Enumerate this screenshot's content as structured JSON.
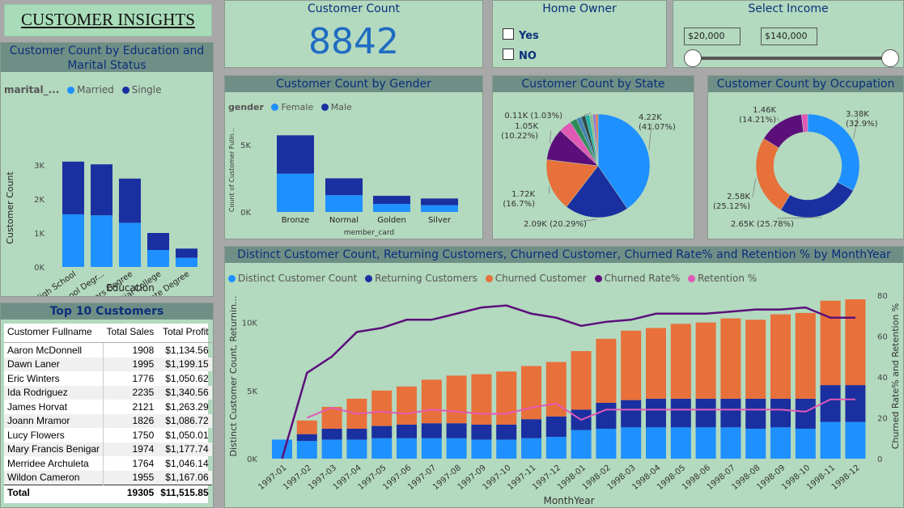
{
  "app_title": "CUSTOMER INSIGHTS",
  "colors": {
    "light_blue": "#1e90ff",
    "dark_blue": "#1a2fa0",
    "orange": "#e8703a",
    "purple": "#5c0f7a",
    "pink": "#e05ab5",
    "panel_bg": "#b3d9bf",
    "title_bar": "#6f8f86",
    "title_text": "#0b2f7a"
  },
  "kpi": {
    "title": "Customer Count",
    "value": "8842"
  },
  "home_owner": {
    "title": "Home Owner",
    "options": [
      {
        "label": "Yes",
        "checked": false
      },
      {
        "label": "NO",
        "checked": false
      }
    ]
  },
  "income": {
    "title": "Select Income",
    "min": "$20,000",
    "max": "$140,000"
  },
  "education_panel": {
    "title": "Customer Count by Education and Marital Status",
    "legend_title": "marital_...",
    "xlabel": "Education",
    "ylabel": "Customer Count"
  },
  "gender_panel": {
    "title": "Customer Count by Gender",
    "legend_title": "gender",
    "xlabel": "member_card",
    "ylabel": "Count of Customer Fulln..."
  },
  "state_panel": {
    "title": "Customer Count by State"
  },
  "occupation_panel": {
    "title": "Customer Count by Occupation"
  },
  "top10": {
    "title": "Top 10 Customers",
    "headers": [
      "Customer Fullname",
      "Total Sales",
      "Total Profit"
    ],
    "rows": [
      [
        "Aaron McDonnell",
        "1908",
        "$1,134.56"
      ],
      [
        "Dawn Laner",
        "1995",
        "$1,199.15"
      ],
      [
        "Eric Winters",
        "1776",
        "$1,050.62"
      ],
      [
        "Ida Rodriguez",
        "2235",
        "$1,340.56"
      ],
      [
        "James Horvat",
        "2121",
        "$1,263.29"
      ],
      [
        "Joann Mramor",
        "1826",
        "$1,086.72"
      ],
      [
        "Lucy Flowers",
        "1750",
        "$1,050.01"
      ],
      [
        "Mary Francis Benigar",
        "1974",
        "$1,177.74"
      ],
      [
        "Merridee Archuleta",
        "1764",
        "$1,046.14"
      ],
      [
        "Wildon Cameron",
        "1955",
        "$1,167.06"
      ]
    ],
    "total": [
      "Total",
      "19305",
      "$11,515.85"
    ]
  },
  "combo_panel": {
    "title": "Distinct Customer Count, Returning Customers, Churned Customer, Churned Rate% and Retention % by MonthYear"
  },
  "chart_data": [
    {
      "type": "bar",
      "stacked": true,
      "categories": [
        "Partial High School",
        "High School Degr...",
        "Bachelors Degree",
        "Partial College",
        "Graduate Degree"
      ],
      "series": [
        {
          "name": "Married",
          "values": [
            1550,
            1520,
            1300,
            500,
            270
          ]
        },
        {
          "name": "Single",
          "values": [
            1550,
            1500,
            1300,
            500,
            270
          ]
        }
      ],
      "xlabel": "Education",
      "ylabel": "Customer Count",
      "yticks": [
        "0K",
        "1K",
        "2K",
        "3K"
      ],
      "ylim": [
        0,
        3500
      ]
    },
    {
      "type": "bar",
      "stacked": true,
      "categories": [
        "Bronze",
        "Normal",
        "Golden",
        "Silver"
      ],
      "series": [
        {
          "name": "Female",
          "values": [
            2850,
            1250,
            600,
            500
          ]
        },
        {
          "name": "Male",
          "values": [
            2850,
            1250,
            600,
            500
          ]
        }
      ],
      "xlabel": "member_card",
      "ylabel": "Count of Customer Fulln...",
      "yticks": [
        "0K",
        "5K"
      ],
      "ylim": [
        0,
        6500
      ]
    },
    {
      "type": "pie",
      "slices": [
        {
          "value": 4220,
          "color": "#1e90ff",
          "label1": "4.22K",
          "label2": "(41.07%)"
        },
        {
          "value": 2090,
          "color": "#1a2fa0",
          "label1": "2.09K (20.29%)",
          "label2": ""
        },
        {
          "value": 1720,
          "color": "#e8703a",
          "label1": "1.72K",
          "label2": "(16.7%)"
        },
        {
          "value": 1050,
          "color": "#5c0f7a",
          "label1": "1.05K",
          "label2": "(10.22%)"
        },
        {
          "value": 420,
          "color": "#e05ab5",
          "label1": "",
          "label2": ""
        },
        {
          "value": 220,
          "color": "#2e8b57",
          "label1": "",
          "label2": ""
        },
        {
          "value": 160,
          "color": "#4682b4",
          "label1": "",
          "label2": ""
        },
        {
          "value": 150,
          "color": "#2f4f4f",
          "label1": "",
          "label2": ""
        },
        {
          "value": 130,
          "color": "#20b2aa",
          "label1": "",
          "label2": ""
        },
        {
          "value": 110,
          "color": "#8fbc8f",
          "label1": "0.11K (1.03%)",
          "label2": ""
        },
        {
          "value": 90,
          "color": "#9370db",
          "label1": "",
          "label2": ""
        },
        {
          "value": 80,
          "color": "#e07050",
          "label1": "",
          "label2": ""
        }
      ]
    },
    {
      "type": "pie",
      "donut": true,
      "slices": [
        {
          "value": 3380,
          "color": "#1e90ff",
          "label1": "3.38K",
          "label2": "(32.9%)"
        },
        {
          "value": 2650,
          "color": "#1a2fa0",
          "label1": "2.65K (25.78%)",
          "label2": ""
        },
        {
          "value": 2580,
          "color": "#e8703a",
          "label1": "2.58K",
          "label2": "(25.12%)"
        },
        {
          "value": 1460,
          "color": "#5c0f7a",
          "label1": "1.46K",
          "label2": "(14.21%)"
        },
        {
          "value": 200,
          "color": "#e05ab5",
          "label1": "",
          "label2": ""
        }
      ]
    },
    {
      "type": "bar+line",
      "categories": [
        "1997-01",
        "1997-02",
        "1997-03",
        "1997-04",
        "1997-05",
        "1997-06",
        "1997-07",
        "1997-08",
        "1997-09",
        "1997-10",
        "1997-11",
        "1997-12",
        "1998-01",
        "1998-02",
        "1998-03",
        "1998-04",
        "1998-05",
        "1998-06",
        "1998-07",
        "1998-08",
        "1998-09",
        "1998-10",
        "1998-11",
        "1998-12"
      ],
      "series": [
        {
          "name": "Distinct Customer Count",
          "axis": "left",
          "values": [
            1400,
            1300,
            1400,
            1400,
            1500,
            1500,
            1500,
            1500,
            1400,
            1400,
            1500,
            1600,
            2100,
            2200,
            2300,
            2300,
            2300,
            2300,
            2300,
            2200,
            2300,
            2200,
            2700,
            2700
          ]
        },
        {
          "name": "Returning Customers",
          "axis": "left",
          "values": [
            0,
            500,
            800,
            800,
            900,
            1000,
            1100,
            1100,
            1100,
            1100,
            1400,
            1500,
            1500,
            1900,
            2000,
            2100,
            2100,
            2100,
            2100,
            2200,
            2100,
            2200,
            2700,
            2700
          ]
        },
        {
          "name": "Churned Customer",
          "axis": "left",
          "values": [
            0,
            1000,
            1600,
            2200,
            2600,
            2800,
            3200,
            3500,
            3700,
            3900,
            3900,
            4000,
            4300,
            4700,
            5100,
            5200,
            5500,
            5600,
            5900,
            5800,
            6200,
            6300,
            6200,
            6300
          ]
        },
        {
          "name": "Churned Rate%",
          "axis": "right",
          "values": [
            0,
            42,
            50,
            62,
            64,
            68,
            68,
            71,
            74,
            75,
            71,
            69,
            65,
            67,
            68,
            71,
            71,
            71,
            72,
            73,
            73,
            74,
            69,
            69
          ]
        },
        {
          "name": "Retention %",
          "axis": "right",
          "values": [
            null,
            20,
            25,
            22,
            23,
            22,
            24,
            23,
            22,
            22,
            25,
            27,
            19,
            24,
            24,
            24,
            24,
            24,
            24,
            24,
            24,
            23,
            29,
            29
          ]
        }
      ],
      "xlabel": "MonthYear",
      "ylabel_left": "Distinct Customer Count, Returnin...",
      "ylabel_right": "Churned Rate% and Retention %",
      "yticks_left": [
        "0K",
        "5K",
        "10K"
      ],
      "ylim_left": [
        0,
        12000
      ],
      "yticks_right": [
        "0",
        "20",
        "40",
        "60",
        "80"
      ],
      "ylim_right": [
        0,
        80
      ]
    }
  ]
}
